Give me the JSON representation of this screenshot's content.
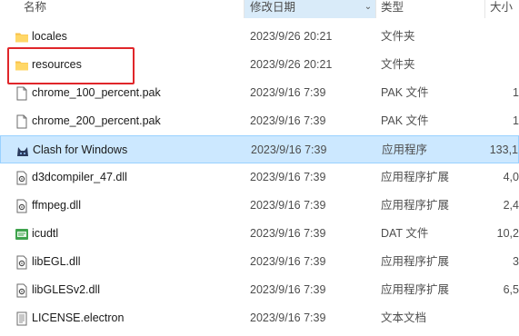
{
  "columns": {
    "name": "名称",
    "date": "修改日期",
    "type": "类型",
    "size": "大小"
  },
  "rows": [
    {
      "name": "locales",
      "date": "2023/9/26 20:21",
      "type": "文件夹",
      "size": "",
      "icon": "folder-icon"
    },
    {
      "name": "resources",
      "date": "2023/9/26 20:21",
      "type": "文件夹",
      "size": "",
      "icon": "folder-icon"
    },
    {
      "name": "chrome_100_percent.pak",
      "date": "2023/9/16 7:39",
      "type": "PAK 文件",
      "size": "1",
      "icon": "file-icon"
    },
    {
      "name": "chrome_200_percent.pak",
      "date": "2023/9/16 7:39",
      "type": "PAK 文件",
      "size": "1",
      "icon": "file-icon"
    },
    {
      "name": "Clash for Windows",
      "date": "2023/9/16 7:39",
      "type": "应用程序",
      "size": "133,1",
      "icon": "clash-app-icon"
    },
    {
      "name": "d3dcompiler_47.dll",
      "date": "2023/9/16 7:39",
      "type": "应用程序扩展",
      "size": "4,0",
      "icon": "dll-icon"
    },
    {
      "name": "ffmpeg.dll",
      "date": "2023/9/16 7:39",
      "type": "应用程序扩展",
      "size": "2,4",
      "icon": "dll-icon"
    },
    {
      "name": "icudtl",
      "date": "2023/9/16 7:39",
      "type": "DAT 文件",
      "size": "10,2",
      "icon": "dat-icon"
    },
    {
      "name": "libEGL.dll",
      "date": "2023/9/16 7:39",
      "type": "应用程序扩展",
      "size": "3",
      "icon": "dll-icon"
    },
    {
      "name": "libGLESv2.dll",
      "date": "2023/9/16 7:39",
      "type": "应用程序扩展",
      "size": "6,5",
      "icon": "dll-icon"
    },
    {
      "name": "LICENSE.electron",
      "date": "2023/9/16 7:39",
      "type": "文本文档",
      "size": "",
      "icon": "text-file-icon"
    }
  ],
  "selected_row": "Clash for Windows",
  "colors": {
    "selection": "#cce8ff",
    "sort_header": "#d9ebf9",
    "annotation_box": "#e0262a",
    "folder": "#f8c24b"
  }
}
